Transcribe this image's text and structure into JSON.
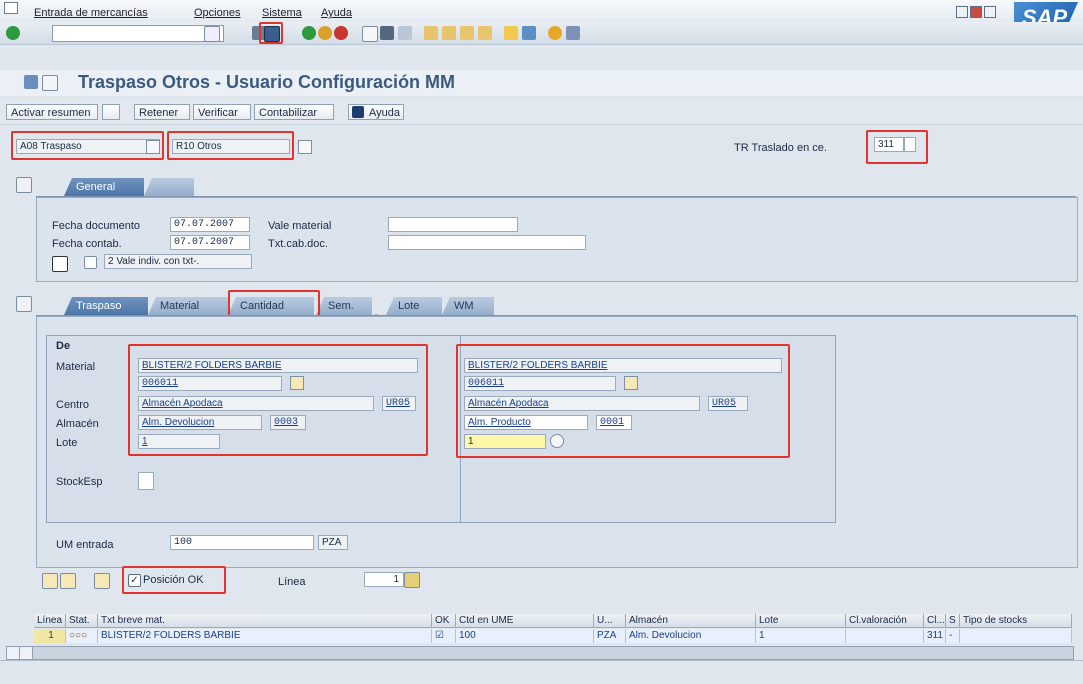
{
  "menu": {
    "items": [
      "Entrada de mercancías",
      "Opciones",
      "Sistema",
      "Ayuda"
    ]
  },
  "brand": {
    "logo_text": "SAP",
    "accent": "#1b5ea8"
  },
  "toolbar": {
    "icons": [
      "enter-icon",
      "save-icon",
      "back-icon",
      "exit-icon",
      "cancel-icon",
      "print-icon",
      "find-icon",
      "find-next-icon",
      "first-page-icon",
      "prev-page-icon",
      "next-page-icon",
      "last-page-icon",
      "new-session-icon",
      "shortcut-icon",
      "help-icon",
      "layout-icon"
    ]
  },
  "title": "Traspaso Otros - Usuario Configuración MM",
  "app_toolbar": {
    "activar": "Activar resumen",
    "retener": "Retener",
    "verificar": "Verificar",
    "contabilizar": "Contabilizar",
    "ayuda": "Ayuda"
  },
  "header": {
    "transaction": "A08 Traspaso",
    "reference": "R10 Otros",
    "movement_label": "TR Traslado en ce.",
    "movement_type": "311"
  },
  "general_tabs": [
    "General"
  ],
  "general": {
    "fecha_doc_label": "Fecha documento",
    "fecha_doc": "07.07.2007",
    "vale_label": "Vale material",
    "vale": "",
    "fecha_contab_label": "Fecha contab.",
    "fecha_contab": "07.07.2007",
    "txt_cab_label": "Txt.cab.doc.",
    "txt_cab": "",
    "print_option": "2 Vale indiv. con txt-."
  },
  "item_tabs": [
    "Traspaso",
    "Material",
    "Cantidad",
    "Sem.",
    "Lote",
    "WM"
  ],
  "from": {
    "section": "De",
    "material_label": "Material",
    "material_desc": "BLISTER/2 FOLDERS BARBIE",
    "material_code": "006011",
    "centro_label": "Centro",
    "centro": "Almacén Apodaca",
    "centro_code": "UR05",
    "almacen_label": "Almacén",
    "almacen": "Alm. Devolucion",
    "almacen_code": "0003",
    "lote_label": "Lote",
    "lote": "1",
    "stock_label": "StockEsp"
  },
  "to": {
    "material_desc": "BLISTER/2 FOLDERS BARBIE",
    "material_code": "006011",
    "centro": "Almacén Apodaca",
    "centro_code": "UR05",
    "almacen": "Alm. Producto",
    "almacen_code": "0001",
    "lote": "1"
  },
  "qty": {
    "label": "UM entrada",
    "value": "100",
    "unit": "PZA"
  },
  "position": {
    "ok_label": "Posición OK",
    "ok_checked": true,
    "linea_label": "Línea",
    "linea": "1"
  },
  "table": {
    "headers": [
      "Línea",
      "Stat.",
      "Txt breve mat.",
      "OK",
      "Ctd en UME",
      "U...",
      "Almacén",
      "Lote",
      "Cl.valoración",
      "Cl...",
      "S",
      "Tipo de stocks"
    ],
    "row": [
      "1",
      "",
      "BLISTER/2 FOLDERS BARBIE",
      "",
      "100",
      "PZA",
      "Alm. Devolucion",
      "1",
      "",
      "311",
      "-",
      ""
    ]
  }
}
